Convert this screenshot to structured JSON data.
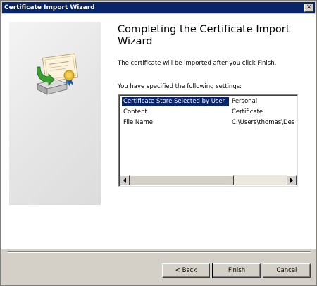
{
  "window": {
    "title": "Certificate Import Wizard",
    "close_glyph": "✕"
  },
  "content": {
    "heading": "Completing the Certificate Import Wizard",
    "subtext": "The certificate will be imported after you click Finish.",
    "settings_label": "You have specified the following settings:",
    "settings": [
      {
        "name": "Certificate Store Selected by User",
        "value": "Personal",
        "selected": true
      },
      {
        "name": "Content",
        "value": "Certificate",
        "selected": false
      },
      {
        "name": "File Name",
        "value": "C:\\Users\\thomas\\Des",
        "selected": false
      }
    ]
  },
  "buttons": {
    "back": "< Back",
    "finish": "Finish",
    "cancel": "Cancel"
  },
  "icons": {
    "wizard_art": "certificate-import-icon",
    "scroll_left": "arrow-left-icon",
    "scroll_right": "arrow-right-icon"
  },
  "colors": {
    "titlebar": "#0a246a",
    "selection": "#0a246a",
    "face": "#d4d0c8"
  }
}
